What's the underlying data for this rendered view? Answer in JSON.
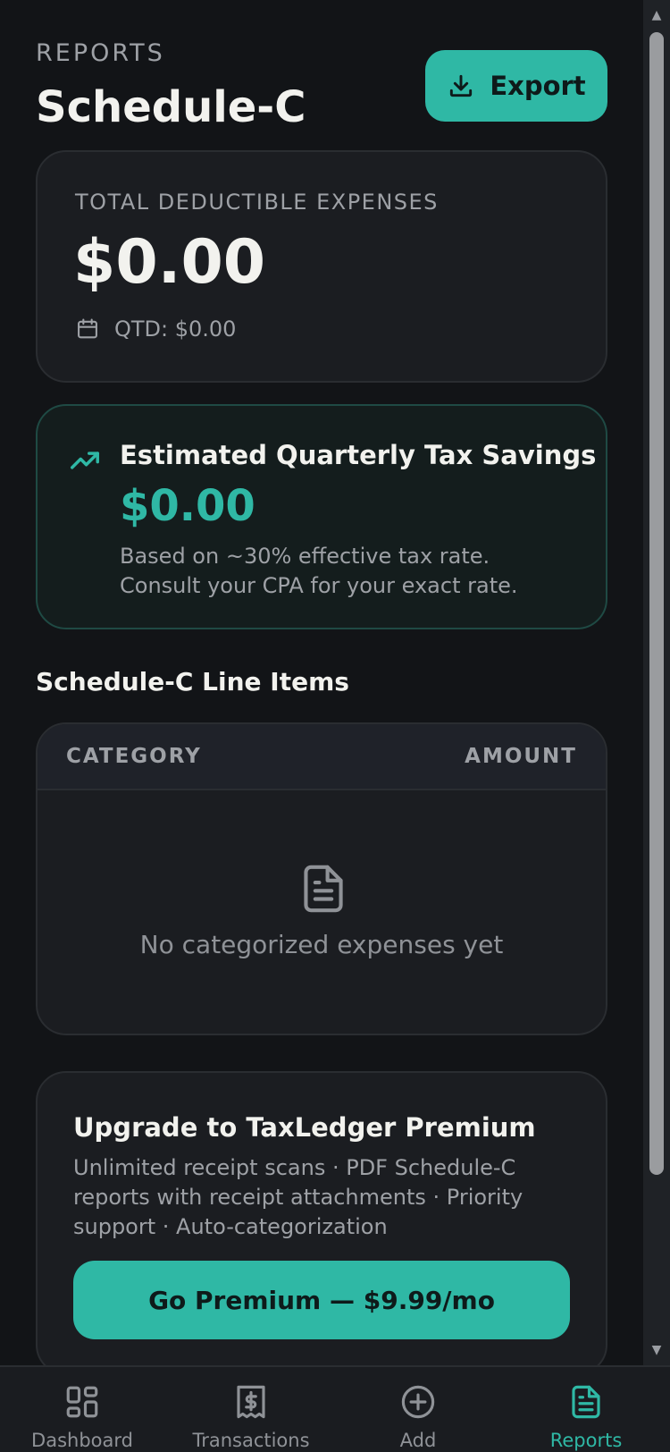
{
  "header": {
    "eyebrow": "REPORTS",
    "title": "Schedule-C",
    "export_label": "Export"
  },
  "total": {
    "label": "TOTAL DEDUCTIBLE EXPENSES",
    "value": "$0.00",
    "qtd": "QTD: $0.00"
  },
  "savings": {
    "title": "Estimated Quarterly Tax Savings",
    "value": "$0.00",
    "note": "Based on ~30% effective tax rate. Consult your CPA for your exact rate."
  },
  "line_items": {
    "section_title": "Schedule-C Line Items",
    "columns": [
      "CATEGORY",
      "AMOUNT"
    ],
    "rows": [],
    "empty_text": "No categorized expenses yet"
  },
  "premium": {
    "title": "Upgrade to TaxLedger Premium",
    "description": "Unlimited receipt scans · PDF Schedule-C reports with receipt attachments · Priority support · Auto-categorization",
    "button_label": "Go Premium — $9.99/mo"
  },
  "nav": {
    "items": [
      {
        "label": "Dashboard",
        "icon": "dashboard-icon"
      },
      {
        "label": "Transactions",
        "icon": "receipt-icon"
      },
      {
        "label": "Add",
        "icon": "plus-circle-icon"
      },
      {
        "label": "Reports",
        "icon": "report-icon"
      }
    ],
    "active_index": 3
  },
  "colors": {
    "accent": "#2fb8a5",
    "background": "#121417",
    "card": "#1b1d21"
  }
}
